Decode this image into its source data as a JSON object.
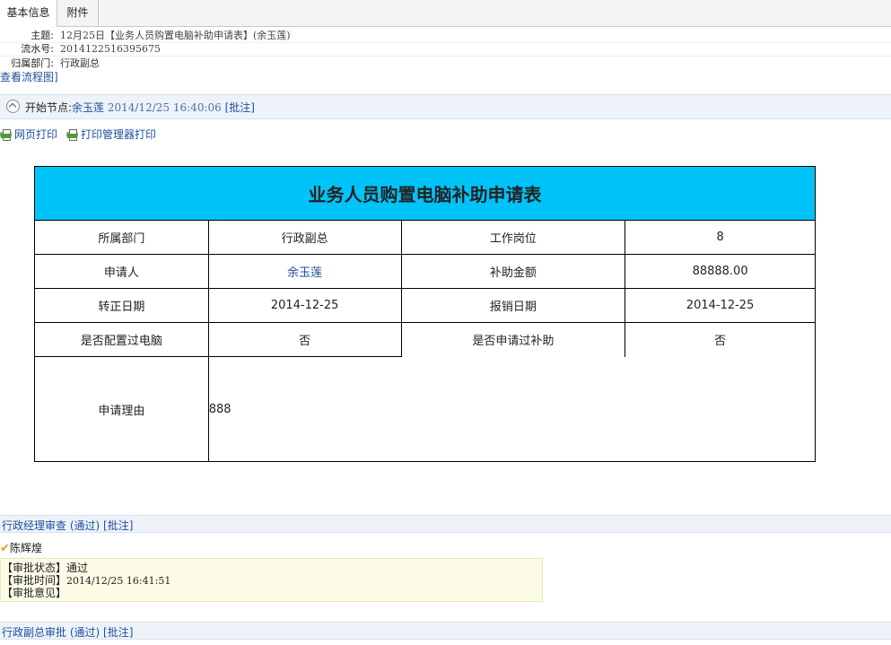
{
  "tabs": [
    "基本信息",
    "附件"
  ],
  "info": {
    "subject_label": "主题:",
    "subject_value": "12月25日【业务人员购置电脑补助申请表】(余玉莲)",
    "serial_label": "流水号:",
    "serial_value": "2014122516395675",
    "dept_label": "归属部门:",
    "dept_value": "行政副总",
    "flow_link": "查看流程图]"
  },
  "start_node": {
    "label": "开始节点:",
    "user": "余玉莲",
    "time": "2014/12/25 16:40:06",
    "comment_link": "[批注]"
  },
  "print": {
    "web_print": "网页打印",
    "manager_print": "打印管理器打印"
  },
  "form": {
    "title": "业务人员购置电脑补助申请表",
    "rows": [
      {
        "l1": "所属部门",
        "v1": "行政副总",
        "l2": "工作岗位",
        "v2": "8"
      },
      {
        "l1": "申请人",
        "v1": "余玉莲",
        "l2": "补助金额",
        "v2": "88888.00"
      },
      {
        "l1": "转正日期",
        "v1": "2014-12-25",
        "l2": "报销日期",
        "v2": "2014-12-25"
      },
      {
        "l1": "是否配置过电脑",
        "v1": "否",
        "l2": "是否申请过补助",
        "v2": "否"
      }
    ],
    "reason_label": "申请理由",
    "reason_value": "888"
  },
  "node1": {
    "title": "行政经理审查 (通过)",
    "comment_link": "[批注]",
    "approver": "陈辉煌",
    "status": "【审批状态】通过",
    "time_label": "【审批时间】",
    "time_value": "2014/12/25 16:41:51",
    "opinion": "【审批意见】"
  },
  "node2": {
    "title": "行政副总审批 (通过)",
    "comment_link": "[批注]"
  },
  "colors": {
    "form_header": "#00c3f7",
    "link": "#1f4e9b",
    "section_bg": "#eef3fa",
    "approval_bg": "#fbfbe6",
    "check": "#f39a1d"
  }
}
